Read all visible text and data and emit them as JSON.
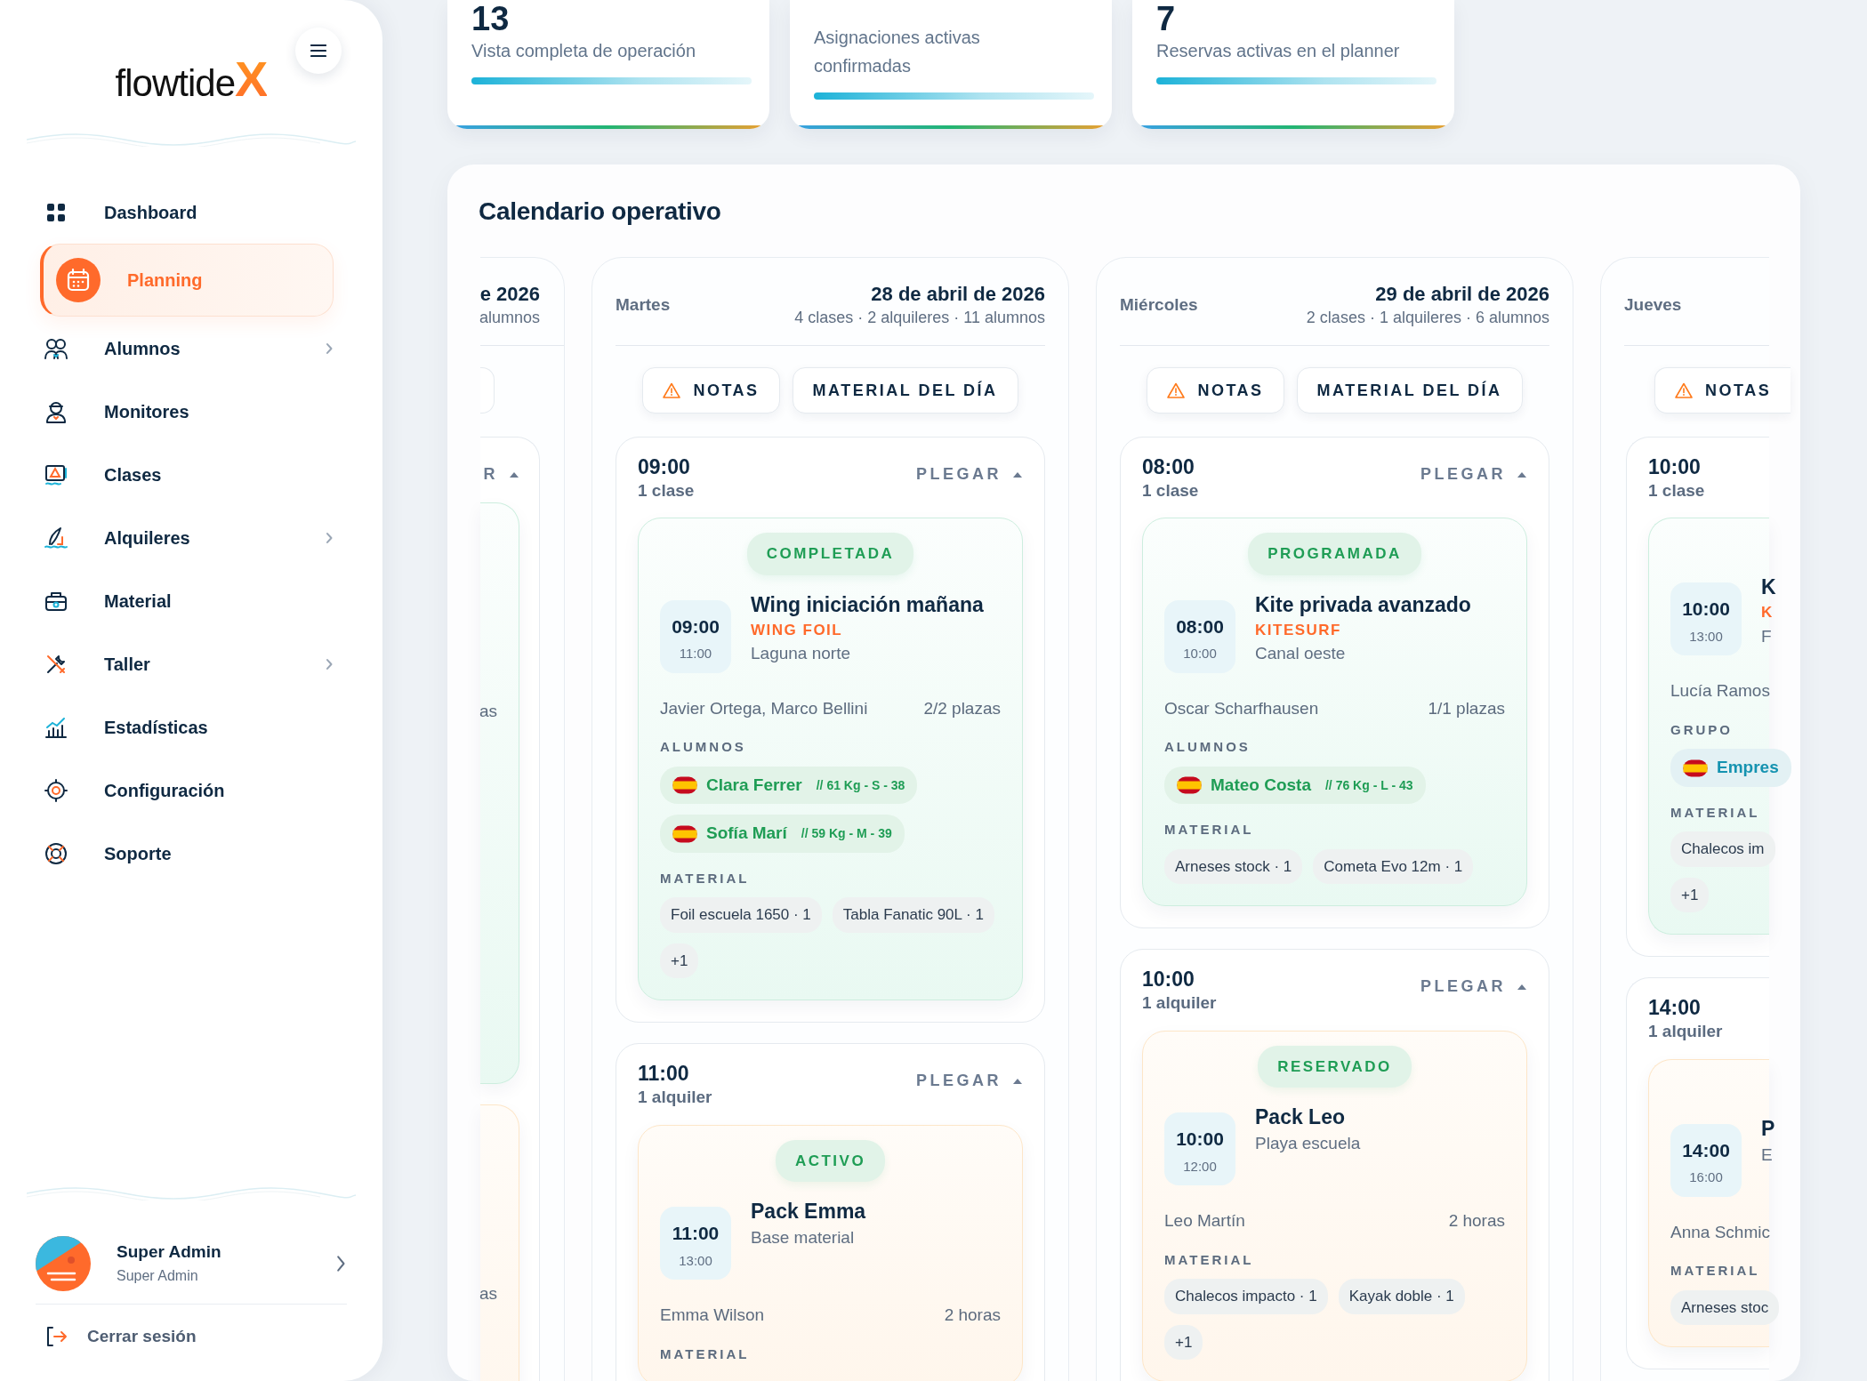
{
  "sidebar": {
    "logo": {
      "text": "flowtide",
      "mark": "X"
    },
    "items": [
      {
        "label": "Dashboard",
        "selected": false,
        "submenu": false
      },
      {
        "label": "Planning",
        "selected": true,
        "submenu": false
      },
      {
        "label": "Alumnos",
        "selected": false,
        "submenu": true
      },
      {
        "label": "Monitores",
        "selected": false,
        "submenu": false
      },
      {
        "label": "Clases",
        "selected": false,
        "submenu": false
      },
      {
        "label": "Alquileres",
        "selected": false,
        "submenu": true
      },
      {
        "label": "Material",
        "selected": false,
        "submenu": false
      },
      {
        "label": "Taller",
        "selected": false,
        "submenu": true
      },
      {
        "label": "Estadísticas",
        "selected": false,
        "submenu": false
      },
      {
        "label": "Configuración",
        "selected": false,
        "submenu": false
      },
      {
        "label": "Soporte",
        "selected": false,
        "submenu": false
      }
    ],
    "user": {
      "name": "Super Admin",
      "role": "Super Admin"
    },
    "logout": "Cerrar sesión"
  },
  "stats": [
    {
      "value": "13",
      "label": "Vista completa de operación"
    },
    {
      "label": "Asignaciones activas confirmadas"
    },
    {
      "value": "7",
      "label": "Reservas activas en el planner"
    }
  ],
  "calendar": {
    "title": "Calendario operativo",
    "days": [
      {
        "cut_left": true,
        "date": "e 2026",
        "summary": "alumnos",
        "slots": [
          {
            "toggle": "R",
            "expanded": true,
            "items": [
              {
                "kind": "class",
                "capacity": "as"
              },
              {
                "kind": "rental",
                "capacity": "as"
              }
            ]
          }
        ]
      },
      {
        "weekday": "Martes",
        "date": "28 de abril de 2026",
        "summary": "4 clases · 2 alquileres · 11 alumnos",
        "notes": "NOTAS",
        "material_button": "MATERIAL DEL DÍA",
        "slots": [
          {
            "time": "09:00",
            "count": "1 clase",
            "toggle": "PLEGAR",
            "expanded": true,
            "items": [
              {
                "kind": "class",
                "status": "COMPLETADA",
                "start": "09:00",
                "end": "11:00",
                "title": "Wing iniciación mañana",
                "sport": "WING FOIL",
                "place": "Laguna norte",
                "people": "Javier Ortega, Marco Bellini",
                "capacity": "2/2 plazas",
                "group_label": "ALUMNOS",
                "students": [
                  {
                    "name": "Clara Ferrer",
                    "details": "// 61 Kg - S - 38",
                    "color": "#1f9d55"
                  },
                  {
                    "name": "Sofía Marí",
                    "details": "// 59 Kg - M - 39",
                    "color": "#1f9d55"
                  }
                ],
                "material_label": "MATERIAL",
                "material": [
                  "Foil escuela 1650 · 1",
                  "Tabla Fanatic 90L · 1",
                  "+1"
                ]
              }
            ]
          },
          {
            "time": "11:00",
            "count": "1 alquiler",
            "toggle": "PLEGAR",
            "expanded": true,
            "items": [
              {
                "kind": "rental",
                "status": "ACTIVO",
                "start": "11:00",
                "end": "13:00",
                "title": "Pack Emma",
                "place": "Base material",
                "people": "Emma Wilson",
                "capacity": "2 horas",
                "material_label": "MATERIAL"
              }
            ]
          }
        ]
      },
      {
        "weekday": "Miércoles",
        "date": "29 de abril de 2026",
        "summary": "2 clases · 1 alquileres · 6 alumnos",
        "notes": "NOTAS",
        "material_button": "MATERIAL DEL DÍA",
        "slots": [
          {
            "time": "08:00",
            "count": "1 clase",
            "toggle": "PLEGAR",
            "expanded": true,
            "items": [
              {
                "kind": "class",
                "status": "PROGRAMADA",
                "start": "08:00",
                "end": "10:00",
                "title": "Kite privada avanzado",
                "sport": "KITESURF",
                "place": "Canal oeste",
                "people": "Oscar Scharfhausen",
                "capacity": "1/1 plazas",
                "group_label": "ALUMNOS",
                "students": [
                  {
                    "name": "Mateo Costa",
                    "details": "// 76 Kg - L - 43",
                    "color": "#1f9d55"
                  }
                ],
                "material_label": "MATERIAL",
                "material": [
                  "Arneses stock · 1",
                  "Cometa Evo 12m · 1"
                ]
              }
            ]
          },
          {
            "time": "10:00",
            "count": "1 alquiler",
            "toggle": "PLEGAR",
            "expanded": true,
            "items": [
              {
                "kind": "rental",
                "status": "RESERVADO",
                "start": "10:00",
                "end": "12:00",
                "title": "Pack Leo",
                "place": "Playa escuela",
                "people": "Leo Martín",
                "capacity": "2 horas",
                "material_label": "MATERIAL",
                "material": [
                  "Chalecos impacto · 1",
                  "Kayak doble · 1",
                  "+1"
                ]
              }
            ]
          }
        ]
      },
      {
        "cut_right": true,
        "weekday": "Jueves",
        "notes": "NOTAS",
        "slots": [
          {
            "time": "10:00",
            "count": "1 clase",
            "items": [
              {
                "kind": "class",
                "start": "10:00",
                "end": "13:00",
                "title": "K",
                "sport": "K",
                "place": "F",
                "people": "Lucía Ramos",
                "group_label": "GRUPO",
                "students": [
                  {
                    "name": "Empres",
                    "color": "#1593b0"
                  }
                ],
                "material_label": "MATERIAL",
                "material": [
                  "Chalecos im",
                  "+1"
                ]
              }
            ]
          },
          {
            "time": "14:00",
            "count": "1 alquiler",
            "items": [
              {
                "kind": "rental",
                "start": "14:00",
                "end": "16:00",
                "title": "P",
                "place": "E",
                "people": "Anna Schmic",
                "material_label": "MATERIAL",
                "material": [
                  "Arneses stoc"
                ]
              }
            ]
          }
        ]
      }
    ]
  }
}
